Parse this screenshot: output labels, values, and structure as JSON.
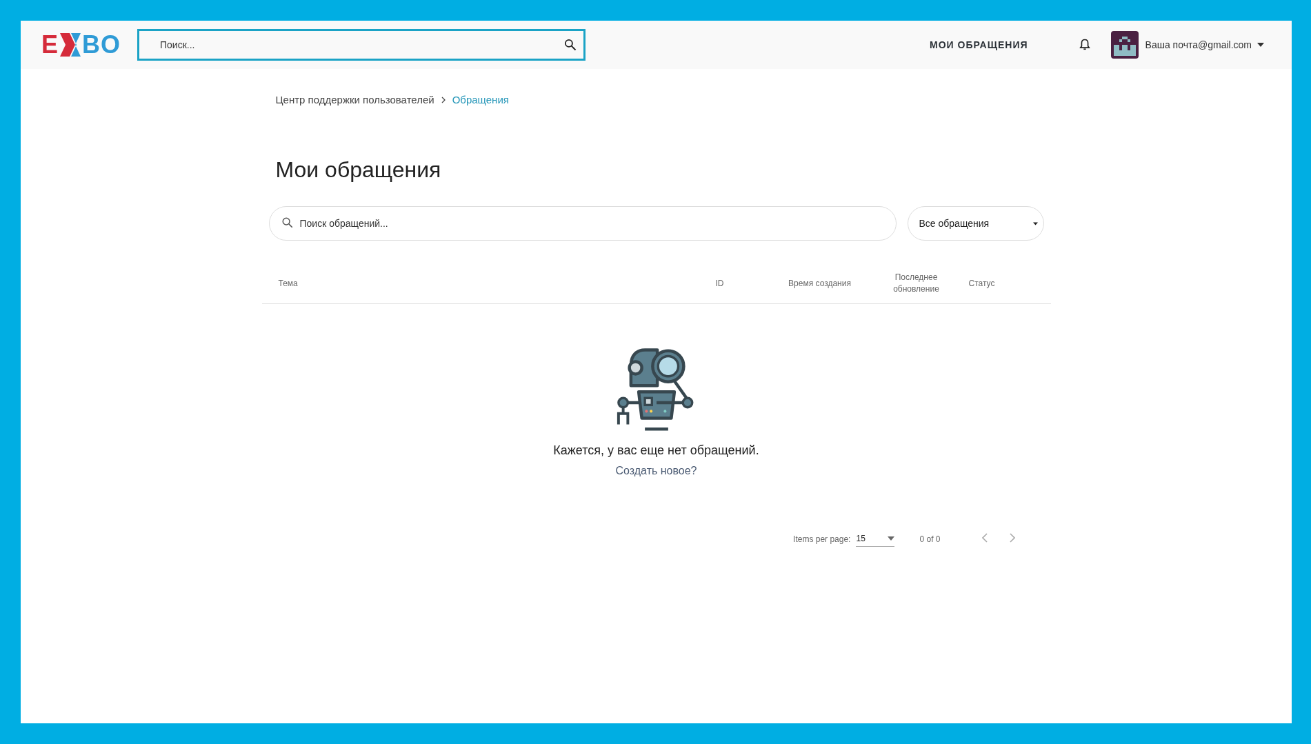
{
  "header": {
    "logo": {
      "left": "E",
      "right": "BO"
    },
    "search": {
      "placeholder": "Поиск..."
    },
    "nav_link": "МОИ ОБРАЩЕНИЯ",
    "user": {
      "email": "Ваша почта@gmail.com"
    }
  },
  "breadcrumb": [
    {
      "label": "Центр поддержки пользователей",
      "current": false
    },
    {
      "label": "Обращения",
      "current": true
    }
  ],
  "page_title": "Мои обращения",
  "filters": {
    "search": {
      "placeholder": "Поиск обращений..."
    },
    "select": {
      "value": "Все обращения"
    }
  },
  "table": {
    "columns": [
      "Тема",
      "ID",
      "Время создания",
      "Последнее обновление",
      "Статус"
    ]
  },
  "empty_state": {
    "message": "Кажется, у вас еще нет обращений.",
    "link": "Создать новое?"
  },
  "pagination": {
    "label": "Items per page:",
    "page_size": "15",
    "range": "0 of 0",
    "prev_disabled": true,
    "next_disabled": true
  }
}
